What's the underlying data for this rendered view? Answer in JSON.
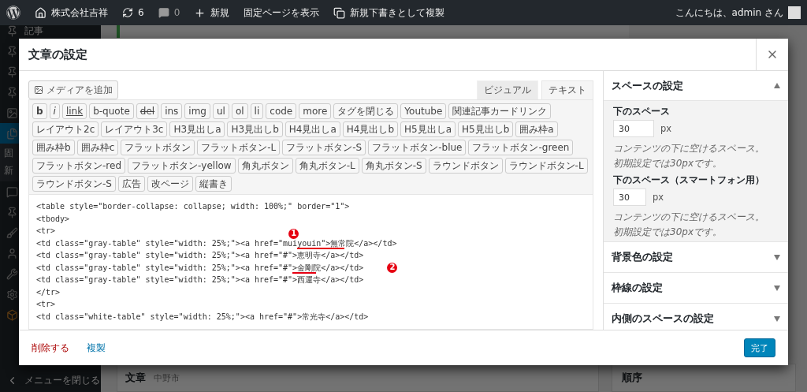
{
  "admin_bar": {
    "site": "株式会社吉祥",
    "updates": "6",
    "comments": "0",
    "new": "新規",
    "view": "固定ページを表示",
    "duplicate": "新規下書きとして複製",
    "greeting": "こんにちは、admin さん"
  },
  "sidebar": {
    "items": [
      {
        "kind": "pin",
        "label": "記事",
        "selected": false
      },
      {
        "kind": "pin",
        "selected": false
      },
      {
        "kind": "pin",
        "selected": false
      },
      {
        "kind": "pin",
        "selected": false
      },
      {
        "kind": "media",
        "selected": false
      },
      {
        "kind": "pages",
        "selected": true,
        "children": [
          {
            "label": "固"
          },
          {
            "label": "新"
          }
        ]
      },
      {
        "kind": "comments",
        "selected": false
      },
      {
        "kind": "pin",
        "selected": false
      },
      {
        "kind": "appearance",
        "selected": false
      },
      {
        "kind": "users",
        "selected": false
      },
      {
        "kind": "tools",
        "selected": false
      },
      {
        "kind": "settings",
        "selected": false
      },
      {
        "kind": "custom",
        "selected": false
      }
    ],
    "collapse": "メニューを閉じる"
  },
  "background": {
    "box_title": "文章",
    "box_subtitle": "中野市",
    "side_title": "順序"
  },
  "modal": {
    "title": "文章の設定",
    "add_media": "メディアを追加",
    "tabs": [
      {
        "label": "ビジュアル",
        "selected": false
      },
      {
        "label": "テキスト",
        "selected": true
      }
    ],
    "quicktags": [
      {
        "label": "b",
        "kind": "bold"
      },
      {
        "label": "i",
        "kind": "italic"
      },
      {
        "label": "link",
        "kind": "link"
      },
      {
        "label": "b-quote",
        "kind": "plain"
      },
      {
        "label": "del",
        "kind": "strike"
      },
      {
        "label": "ins",
        "kind": "plain"
      },
      {
        "label": "img",
        "kind": "plain"
      },
      {
        "label": "ul",
        "kind": "plain"
      },
      {
        "label": "ol",
        "kind": "plain"
      },
      {
        "label": "li",
        "kind": "plain"
      },
      {
        "label": "code",
        "kind": "plain"
      },
      {
        "label": "more",
        "kind": "plain"
      },
      {
        "label": "タグを閉じる",
        "kind": "plain"
      },
      {
        "label": "Youtube",
        "kind": "plain"
      },
      {
        "label": "関連記事カードリンク",
        "kind": "plain"
      },
      {
        "label": "レイアウト2c",
        "kind": "plain"
      },
      {
        "label": "レイアウト3c",
        "kind": "plain"
      },
      {
        "label": "H3見出しa",
        "kind": "plain"
      },
      {
        "label": "H3見出しb",
        "kind": "plain"
      },
      {
        "label": "H4見出しa",
        "kind": "plain"
      },
      {
        "label": "H4見出しb",
        "kind": "plain"
      },
      {
        "label": "H5見出しa",
        "kind": "plain"
      },
      {
        "label": "H5見出しb",
        "kind": "plain"
      },
      {
        "label": "囲み枠a",
        "kind": "plain"
      },
      {
        "label": "囲み枠b",
        "kind": "plain"
      },
      {
        "label": "囲み枠c",
        "kind": "plain"
      },
      {
        "label": "フラットボタン",
        "kind": "plain"
      },
      {
        "label": "フラットボタン-L",
        "kind": "plain"
      },
      {
        "label": "フラットボタン-S",
        "kind": "plain"
      },
      {
        "label": "フラットボタン-blue",
        "kind": "plain"
      },
      {
        "label": "フラットボタン-green",
        "kind": "plain"
      },
      {
        "label": "フラットボタン-red",
        "kind": "plain"
      },
      {
        "label": "フラットボタン-yellow",
        "kind": "plain"
      },
      {
        "label": "角丸ボタン",
        "kind": "plain"
      },
      {
        "label": "角丸ボタン-L",
        "kind": "plain"
      },
      {
        "label": "角丸ボタン-S",
        "kind": "plain"
      },
      {
        "label": "ラウンドボタン",
        "kind": "plain"
      },
      {
        "label": "ラウンドボタン-L",
        "kind": "plain"
      },
      {
        "label": "ラウンドボタン-S",
        "kind": "plain"
      },
      {
        "label": "広告",
        "kind": "plain"
      },
      {
        "label": "改ページ",
        "kind": "plain"
      },
      {
        "label": "縦書き",
        "kind": "plain"
      }
    ],
    "code_lines": [
      {
        "text": "<table style=\"border-collapse: collapse; width: 100%;\" border=\"1\">"
      },
      {
        "text": "<tbody>"
      },
      {
        "text": "<tr>"
      },
      {
        "text": "<td class=\"gray-table\" style=\"width: 25%;\"><a href=\"muiyouin\">無常院</a></td>",
        "marker": "1"
      },
      {
        "text": "<td class=\"gray-table\" style=\"width: 25%;\"><a href=\"#\">恵明寺</a></td>"
      },
      {
        "text": "<td class=\"gray-table\" style=\"width: 25%;\"><a href=\"#\">金剛院</a></td>",
        "marker": "2"
      },
      {
        "text": "<td class=\"gray-table\" style=\"width: 25%;\"><a href=\"#\">西運寺</a></td>"
      },
      {
        "text": "</tr>"
      },
      {
        "text": "<tr>"
      },
      {
        "text": "<td class=\"white-table\" style=\"width: 25%;\"><a href=\"#\">常光寺</a></td>"
      }
    ],
    "sections": [
      {
        "title": "スペースの設定",
        "expanded": true,
        "fields": [
          {
            "label": "下のスペース",
            "value": "30",
            "unit": "px",
            "help": [
              "コンテンツの下に空けるスペース。",
              "初期設定では30pxです。"
            ]
          },
          {
            "label": "下のスペース（スマートフォン用）",
            "value": "30",
            "unit": "px",
            "help": [
              "コンテンツの下に空けるスペース。",
              "初期設定では30pxです。"
            ]
          }
        ]
      },
      {
        "title": "背景色の設定",
        "expanded": false
      },
      {
        "title": "枠線の設定",
        "expanded": false
      },
      {
        "title": "内側のスペースの設定",
        "expanded": false
      }
    ],
    "delete": "削除する",
    "duplicate": "複製",
    "done": "完了"
  }
}
